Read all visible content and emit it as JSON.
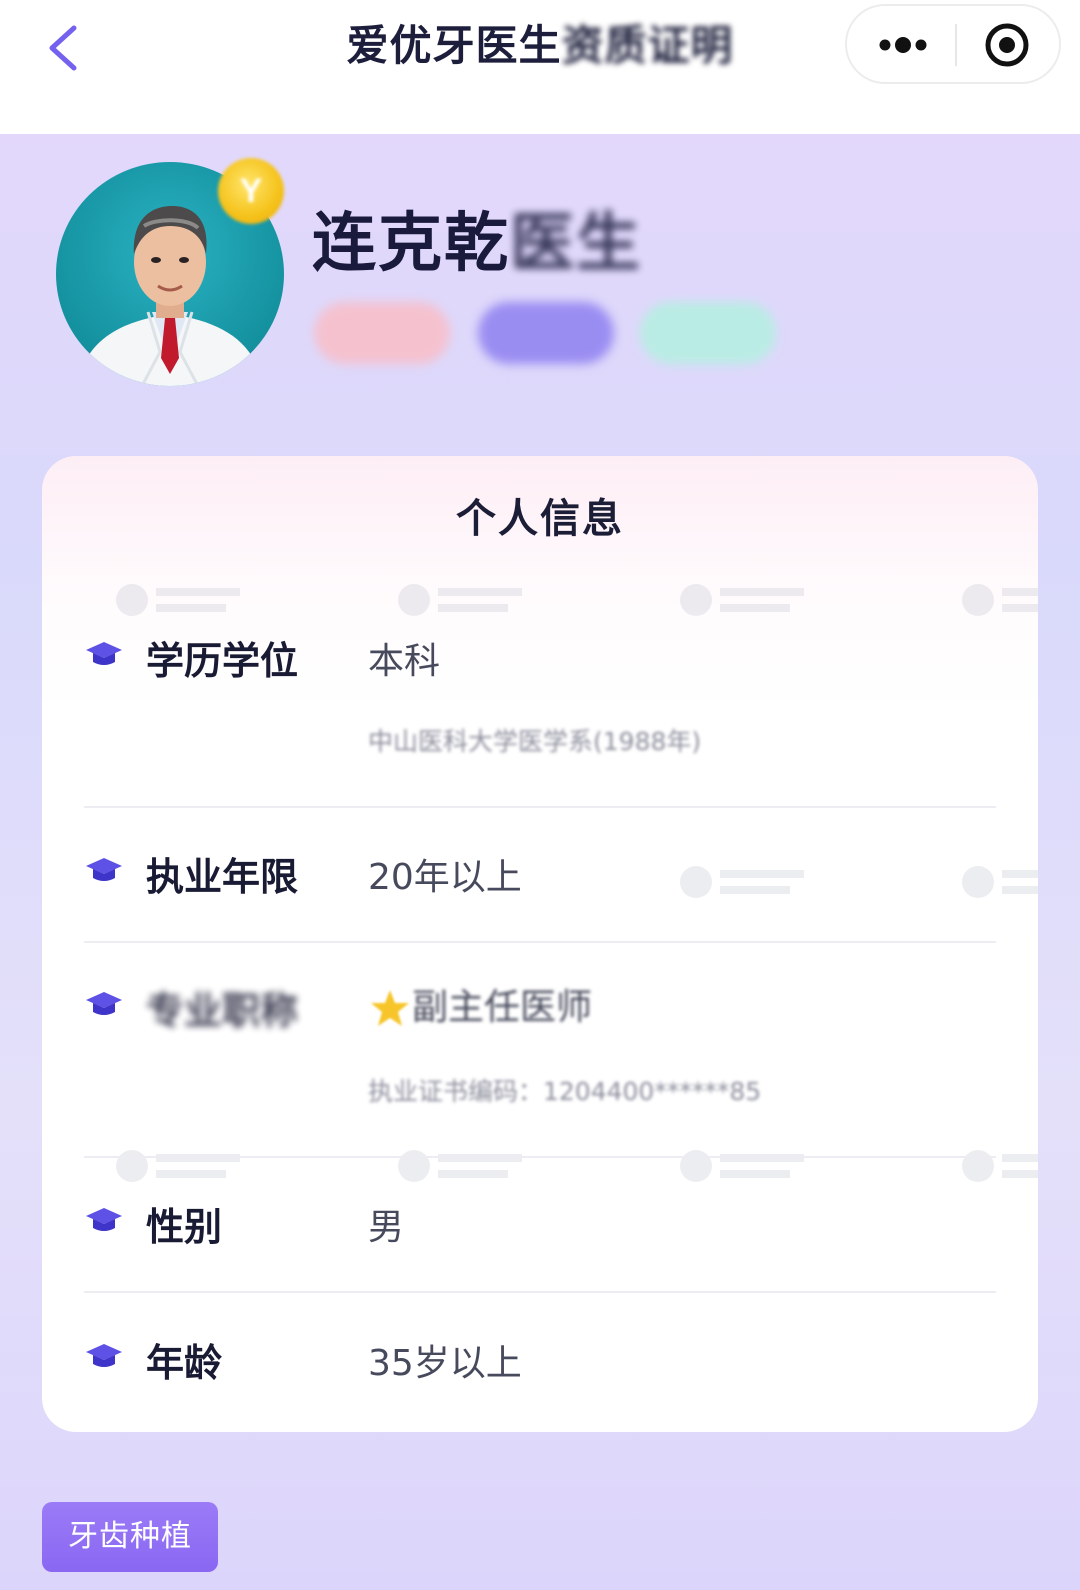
{
  "nav": {
    "title": "爱优牙医生资质证明",
    "title_visible": "爱优牙医生",
    "title_blurred": "资质证明"
  },
  "doctor": {
    "name_visible": "连克乾",
    "name_blurred": "医生",
    "vip_badge_text": "Y",
    "tags": [
      "",
      "",
      ""
    ]
  },
  "card": {
    "title": "个人信息",
    "rows": [
      {
        "label": "学历学位",
        "value": "本科",
        "sub": "中山医科大学医学系(1988年)"
      },
      {
        "label": "执业年限",
        "value": "20年以上"
      },
      {
        "label": "专业职称",
        "value": "副主任医师",
        "sub": "执业证书编码：1204400******85"
      },
      {
        "label": "性别",
        "value": "男"
      },
      {
        "label": "年龄",
        "value": "35岁以上"
      }
    ]
  },
  "bottom_tag": "牙齿种植",
  "colors": {
    "accent": "#7b6ef3",
    "background": "#e0d8fb",
    "icon": "#5d51e6",
    "title": "#1c1e3b"
  },
  "icons": {
    "back": "chevron-left-icon",
    "more": "more-dots-icon",
    "close": "target-circle-icon",
    "row": "graduation-cap-icon",
    "star": "star-icon"
  }
}
